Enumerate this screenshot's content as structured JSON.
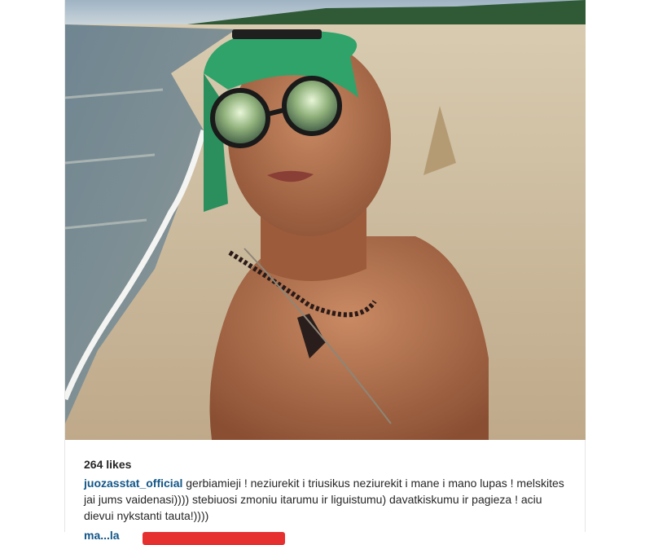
{
  "post": {
    "likes": "264 likes",
    "caption": {
      "username": "juozasstat_official",
      "text": " gerbiamieji ! neziurekit i triusikus neziurekit i mane i mano lupas ! melskites jai jums vaidenasi)))) stebiuosi zmoniu itarumu ir liguistumu) davatkiskumu ir pagieza ! aciu dievui nykstanti tauta!))))"
    },
    "comment": {
      "username": "ma...la"
    }
  }
}
